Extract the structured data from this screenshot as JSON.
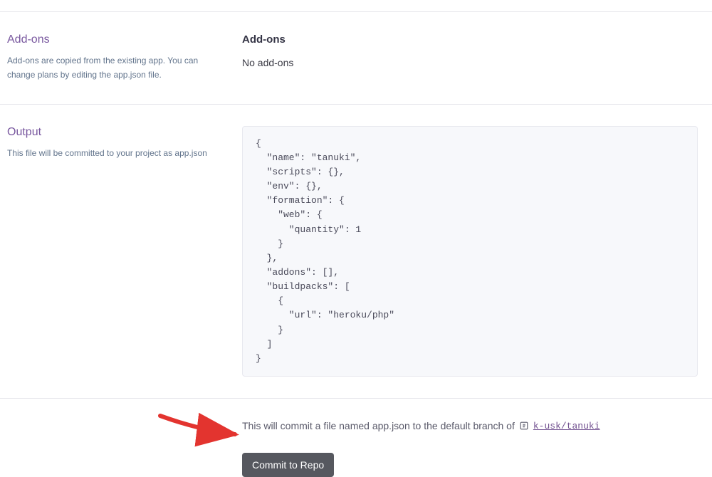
{
  "addons": {
    "heading": "Add-ons",
    "description": "Add-ons are copied from the existing app. You can change plans by editing the app.json file.",
    "sub_heading": "Add-ons",
    "empty_text": "No add-ons"
  },
  "output": {
    "heading": "Output",
    "description": "This file will be committed to your project as app.json",
    "code": "{\n  \"name\": \"tanuki\",\n  \"scripts\": {},\n  \"env\": {},\n  \"formation\": {\n    \"web\": {\n      \"quantity\": 1\n    }\n  },\n  \"addons\": [],\n  \"buildpacks\": [\n    {\n      \"url\": \"heroku/php\"\n    }\n  ]\n}"
  },
  "footer": {
    "commit_text_prefix": "This will commit a file named app.json to the default branch of",
    "repo_link": "k-usk/tanuki",
    "button_label": "Commit to Repo"
  }
}
